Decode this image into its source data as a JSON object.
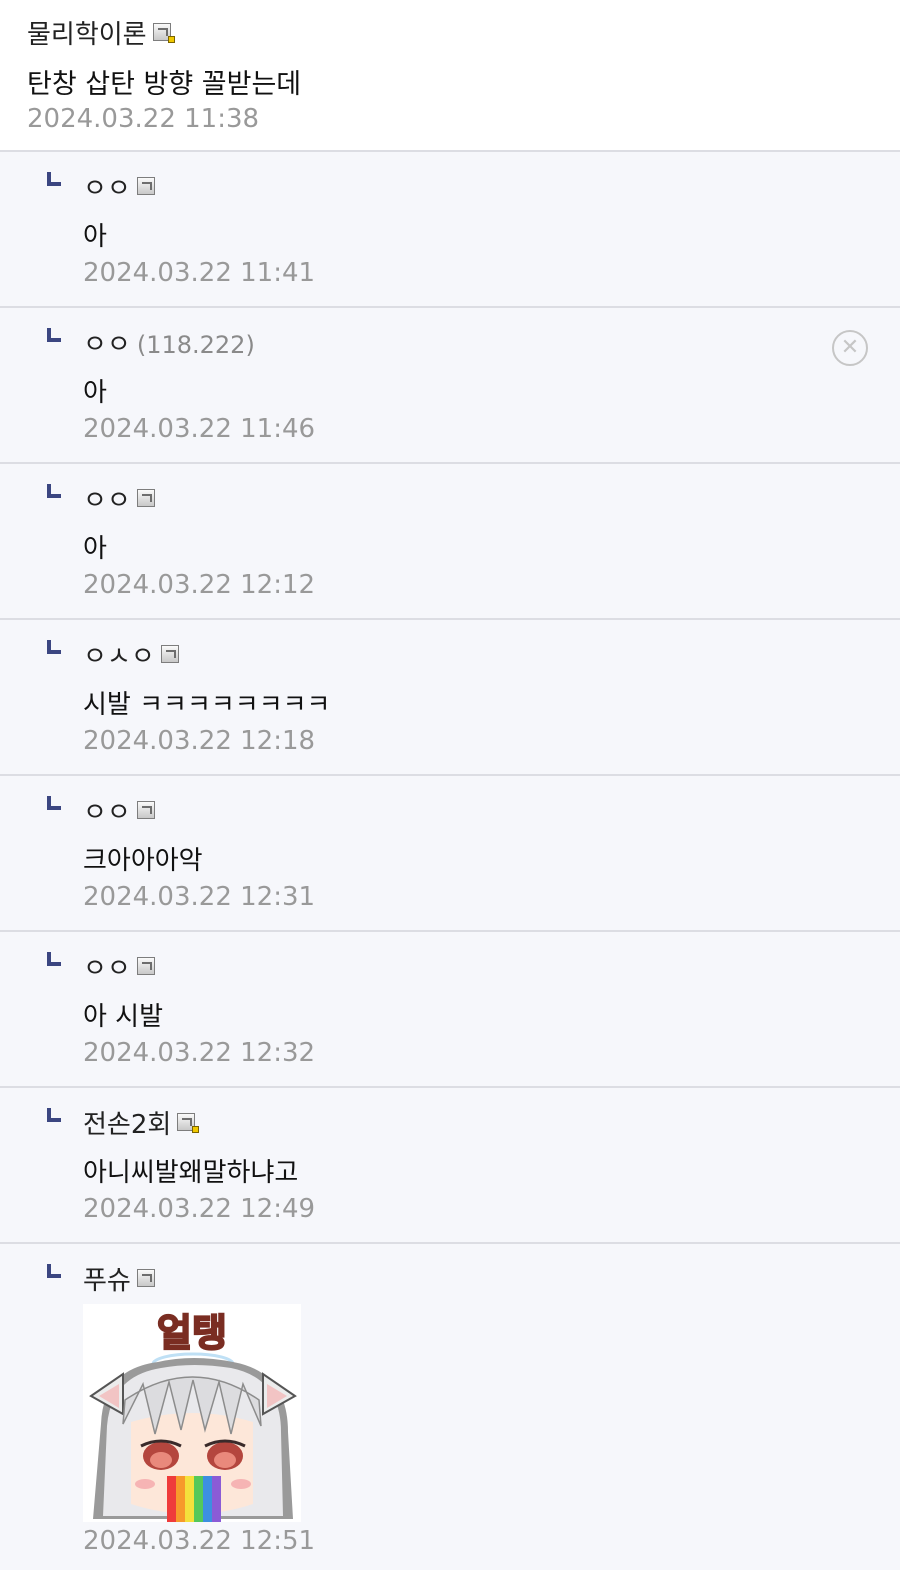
{
  "main_comment": {
    "author": "물리학이론",
    "text": "탄창 삽탄 방향 꼴받는데",
    "time": "2024.03.22 11:38"
  },
  "replies": [
    {
      "author": "ㅇㅇ",
      "text": "아",
      "time": "2024.03.22 11:41"
    },
    {
      "author": "ㅇㅇ",
      "ip": "(118.222)",
      "text": "아",
      "time": "2024.03.22 11:46",
      "delete_icon": "close-circle-icon"
    },
    {
      "author": "ㅇㅇ",
      "text": "아",
      "time": "2024.03.22 12:12"
    },
    {
      "author": "ㅇㅅㅇ",
      "text": "시발 ㅋㅋㅋㅋㅋㅋㅋㅋ",
      "time": "2024.03.22 12:18"
    },
    {
      "author": "ㅇㅇ",
      "text": "크아아아악",
      "time": "2024.03.22 12:31"
    },
    {
      "author": "ㅇㅇ",
      "text": "아 시발",
      "time": "2024.03.22 12:32"
    },
    {
      "author": "전손2회",
      "text": "아니씨발왜말하냐고",
      "time": "2024.03.22 12:49"
    },
    {
      "author": "푸슈",
      "dccon_text": "얼탱",
      "time": "2024.03.22 12:51"
    }
  ],
  "colors": {
    "reply_bg": "#f6f7fb",
    "arrow": "#3b4681",
    "time": "#999999",
    "divider": "#dcdde3"
  }
}
